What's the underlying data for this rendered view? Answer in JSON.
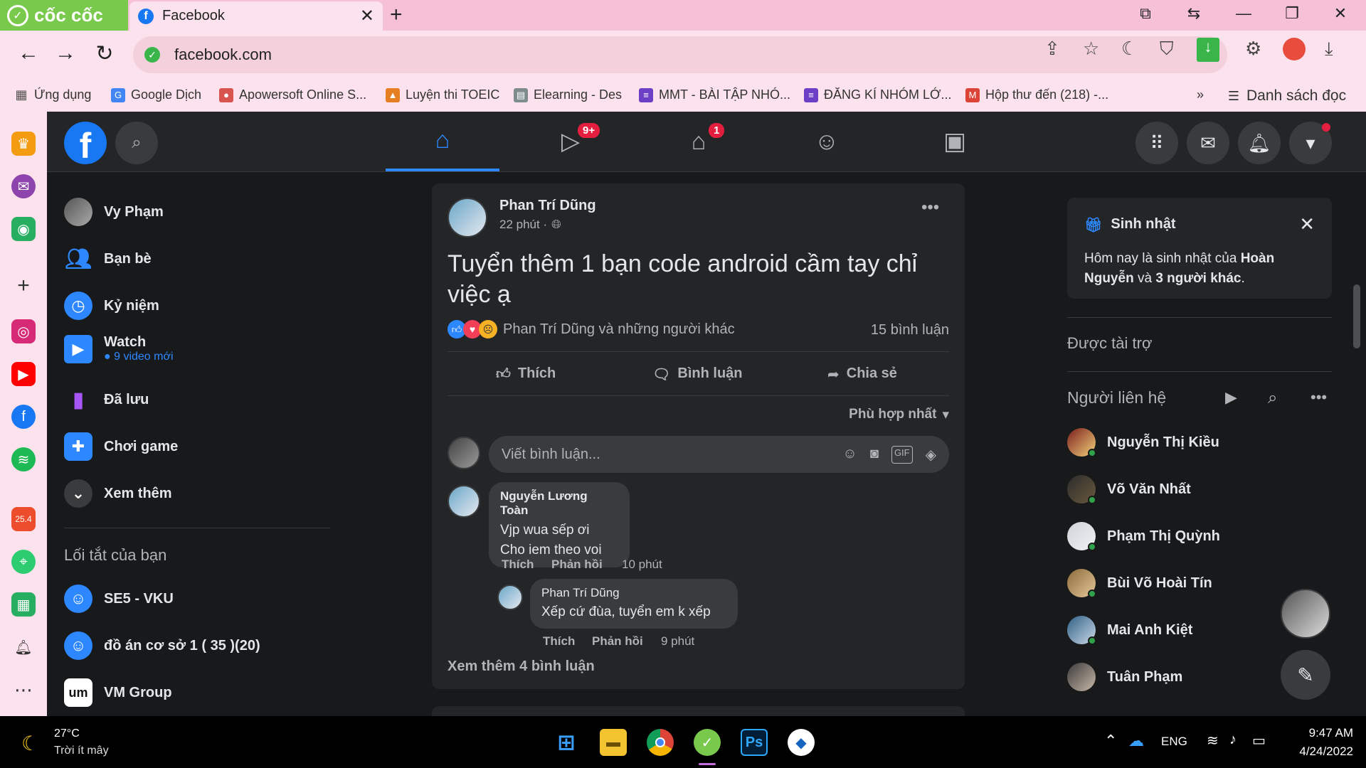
{
  "browser": {
    "brand": "cốc cốc",
    "tab_title": "Facebook",
    "url": "facebook.com",
    "bookmarks": [
      {
        "label": "Ứng dụng",
        "color": "#555555"
      },
      {
        "label": "Google Dịch",
        "color": "#4285f4"
      },
      {
        "label": "Apowersoft Online S...",
        "color": "#d9534f"
      },
      {
        "label": "Luyện thi TOEIC",
        "color": "#e67e22"
      },
      {
        "label": "Elearning - Des",
        "color": "#7f8c8d"
      },
      {
        "label": "MMT - BÀI TẬP NHÓ...",
        "color": "#6c3fc7"
      },
      {
        "label": "ĐĂNG KÍ NHÓM LỚ...",
        "color": "#6c3fc7"
      },
      {
        "label": "Hộp thư đến (218) -...",
        "color": "#db4437"
      }
    ],
    "more_bookmarks": "»",
    "reading_list": "Danh sách đọc"
  },
  "fb_header": {
    "logo": "f",
    "video_badge": "9+",
    "marketplace_badge": "1"
  },
  "leftnav": {
    "items": [
      {
        "label": "Vy Phạm",
        "icon": "profile-avatar"
      },
      {
        "label": "Bạn bè",
        "icon": "friends-icon"
      },
      {
        "label": "Kỷ niệm",
        "icon": "memories-icon"
      },
      {
        "label": "Watch",
        "sub": "9 video mới",
        "icon": "watch-icon"
      },
      {
        "label": "Đã lưu",
        "icon": "saved-icon"
      },
      {
        "label": "Chơi game",
        "icon": "gaming-icon"
      },
      {
        "label": "Xem thêm",
        "icon": "chevron-down-icon"
      }
    ],
    "shortcuts_title": "Lối tắt của bạn",
    "shortcuts": [
      {
        "label": "SE5 - VKU"
      },
      {
        "label": "đồ án cơ sở 1 ( 35 )(20)"
      },
      {
        "label": "VM Group",
        "logo": "um"
      }
    ]
  },
  "post": {
    "author": "Phan Trí Dũng",
    "time": "22 phút ·",
    "text": "Tuyển thêm 1 bạn code android cầm tay chỉ việc ạ",
    "reactions_text": "Phan Trí Dũng và những người khác",
    "comments_count": "15 bình luận",
    "actions": {
      "like": "Thích",
      "comment": "Bình luận",
      "share": "Chia sẻ"
    },
    "sort": "Phù hợp nhất",
    "comment_placeholder": "Viết bình luận...",
    "comments": [
      {
        "name": "Nguyễn Lương Toàn",
        "lines": [
          "Vjp wua sếp ơi",
          "Cho iem theo voi"
        ],
        "like": "Thích",
        "reply": "Phản hồi",
        "time": "10 phút"
      },
      {
        "name": "Phan Trí Dũng",
        "lines": [
          "Xếp cứ đùa, tuyển em k xếp"
        ],
        "like": "Thích",
        "reply": "Phản hồi",
        "time": "9 phút"
      }
    ],
    "more_comments": "Xem thêm 4 bình luận"
  },
  "rightcol": {
    "birthday_title": "Sinh nhật",
    "birthday_text_pre": "Hôm nay là sinh nhật của ",
    "birthday_name": "Hoàn Nguyễn",
    "birthday_mid": " và ",
    "birthday_others": "3 người khác",
    "birthday_end": ".",
    "sponsored": "Được tài trợ",
    "contacts_title": "Người liên hệ",
    "contacts": [
      {
        "name": "Nguyễn Thị Kiều"
      },
      {
        "name": "Võ Văn Nhất"
      },
      {
        "name": "Phạm Thị Quỳnh"
      },
      {
        "name": "Bùi Võ Hoài Tín"
      },
      {
        "name": "Mai Anh Kiệt"
      },
      {
        "name": "Tuân Phạm"
      }
    ]
  },
  "taskbar": {
    "temp": "27°C",
    "weather": "Trời ít mây",
    "lang": "ENG",
    "time": "9:47 AM",
    "date": "4/24/2022"
  }
}
